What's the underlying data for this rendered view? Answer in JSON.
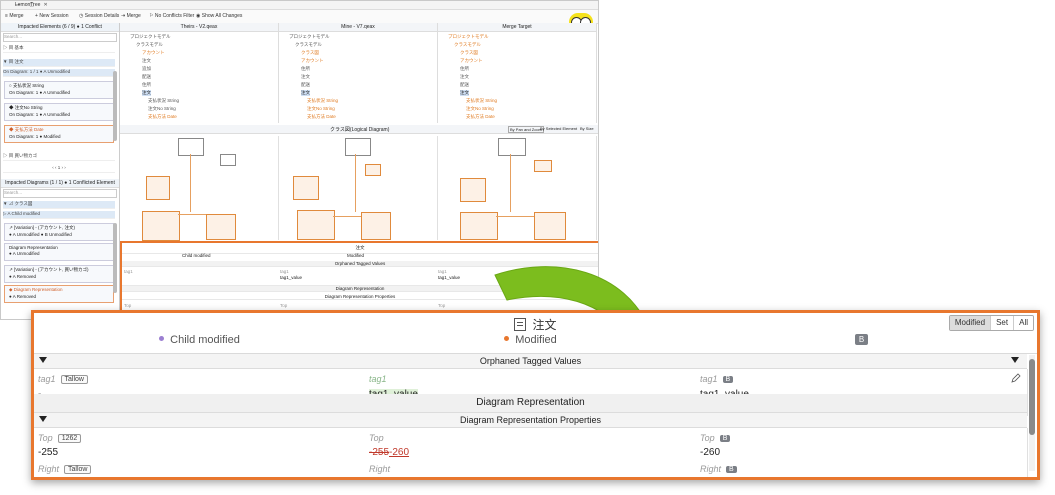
{
  "app": {
    "window_title": "LemonTree",
    "toolbar": {
      "merge_label": "Merge",
      "new_session": "New Session",
      "session_details": "Session Details",
      "merge_btn": "Merge",
      "no_conflicts": "No Conflicts Filter",
      "show_all": "Show All Changes"
    },
    "left_panel": {
      "elements_header": "Impacted Elements (6 / 9) ● 1 Conflict",
      "search_placeholder": "Search...",
      "rows": [
        "▷ 目 基本",
        "▼ 目 注文",
        "On Diagram: 1 / 1  ● A  Unmodified",
        "▼ 目 Modified",
        "○ 支払状況 String",
        "On Diagram: 1  ● A  Unmodified",
        "◆ 注文No String",
        "On Diagram: 1  ● A  Unmodified",
        "◆ 支払方法 Date",
        "On Diagram: 1  ● Modified",
        "▷ 目 買い物カゴ"
      ],
      "pager": "‹ ‹ 1 › ›",
      "diagrams_header": "Impacted Diagrams (1 / 1) ● 1 Conflicted Element",
      "diag_rows": [
        "▼ ⊿ クラス図",
        "▷ A  Child modified",
        "↗ [Variation] - (アカウント, 注文)",
        "● A  Unmodified  ● B  Unmodified",
        "Diagram Representation",
        "● A  Unmodified",
        "↗ [Variation] - (アカウント, 買い物カゴ)",
        "● A  Removed",
        "◆ Diagram Representation",
        "● A  Removed"
      ]
    },
    "trees": [
      {
        "header": "Theirs - V2.qeax",
        "rows": [
          "プロジェクトモデル",
          "クラスモデル",
          "アカウント",
          "注文",
          "追加",
          "配送",
          "住所",
          "注文",
          "ステータス",
          "支払状況 String",
          "注文No String",
          "支払方法 Date"
        ]
      },
      {
        "header": "Mine - V7.qeax",
        "rows": [
          "プロジェクトモデル",
          "クラスモデル",
          "クラス図",
          "アカウント",
          "住所",
          "注文",
          "配送",
          "支払",
          "注文",
          "支払状況 String",
          "注文No String",
          "支払方法 Date"
        ]
      },
      {
        "header": "Merge Target",
        "rows": [
          "プロジェクトモデル",
          "クラスモデル",
          "クラス図",
          "アカウント",
          "住所",
          "注文",
          "配送",
          "支払",
          "注文",
          "支払状況 String",
          "注文No String",
          "支払方法 Date"
        ]
      }
    ],
    "diagram_title": "クラス図(Logical Diagram)",
    "diagram_tabs": [
      "By Pan and Zoom",
      "By Selected Element",
      "By Size"
    ],
    "detail": {
      "title": "注文",
      "child_modified": "Child modified",
      "modified": "Modified",
      "orphaned": "Orphaned Tagged Values",
      "diagram_rep": "Diagram Representation",
      "diagram_rep_props": "Diagram Representation Properties",
      "tag1": "tag1",
      "tag1_value": "tag1_value",
      "top": "Top",
      "top_value": "-255",
      "right": "Right"
    }
  },
  "zoom": {
    "title": "注文",
    "col_a_status": "Child modified",
    "col_b_status": "Modified",
    "col_c_badge": "B",
    "segmented": [
      "Modified",
      "Set",
      "All"
    ],
    "section_orphaned": "Orphaned Tagged Values",
    "row_tag1": {
      "a_label": "tag1",
      "a_tag": "Tallow",
      "a_value": "-",
      "b_label": "tag1",
      "b_value": "tag1_value",
      "c_label": "tag1",
      "c_badge": "B",
      "c_value": "tag1_value"
    },
    "section_diagram_rep": "Diagram Representation",
    "section_diagram_rep_props": "Diagram Representation Properties",
    "row_top": {
      "a_label": "Top",
      "a_tag": "1262",
      "a_value": "-255",
      "b_label": "Top",
      "b_old": "-255",
      "b_new": "-260",
      "c_label": "Top",
      "c_badge": "B",
      "c_value": "-260"
    },
    "row_right": {
      "a_label": "Right",
      "a_tag": "Tallow",
      "b_label": "Right",
      "c_label": "Right",
      "c_badge": "B"
    }
  },
  "colors": {
    "accent_orange": "#e8772e",
    "arrow_green": "#7cbd1e",
    "child_modified_dot": "#9b7fd1",
    "modified_dot": "#e8772e"
  }
}
